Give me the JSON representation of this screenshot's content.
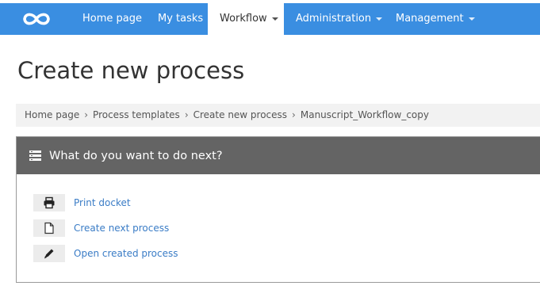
{
  "nav": {
    "items": [
      {
        "label": "Home page",
        "dropdown": false,
        "active": false
      },
      {
        "label": "My tasks",
        "dropdown": false,
        "active": false
      },
      {
        "label": "Workflow",
        "dropdown": true,
        "active": true
      },
      {
        "label": "Administration",
        "dropdown": true,
        "active": false
      },
      {
        "label": "Management",
        "dropdown": true,
        "active": false
      }
    ],
    "logo_icon": "infinity-logo-icon",
    "bar_color": "#3a8ee1"
  },
  "page": {
    "title": "Create new process"
  },
  "breadcrumb": {
    "items": [
      "Home page",
      "Process templates",
      "Create new process",
      "Manuscript_Workflow_copy"
    ],
    "separator": "›"
  },
  "panel": {
    "icon": "list-icon",
    "title": "What do you want to do next?",
    "heading_color": "#646464",
    "actions": [
      {
        "label": "Print docket",
        "icon": "printer-icon"
      },
      {
        "label": "Create next process",
        "icon": "file-icon"
      },
      {
        "label": "Open created process",
        "icon": "pencil-icon"
      }
    ],
    "link_color": "#3a7cc6"
  }
}
